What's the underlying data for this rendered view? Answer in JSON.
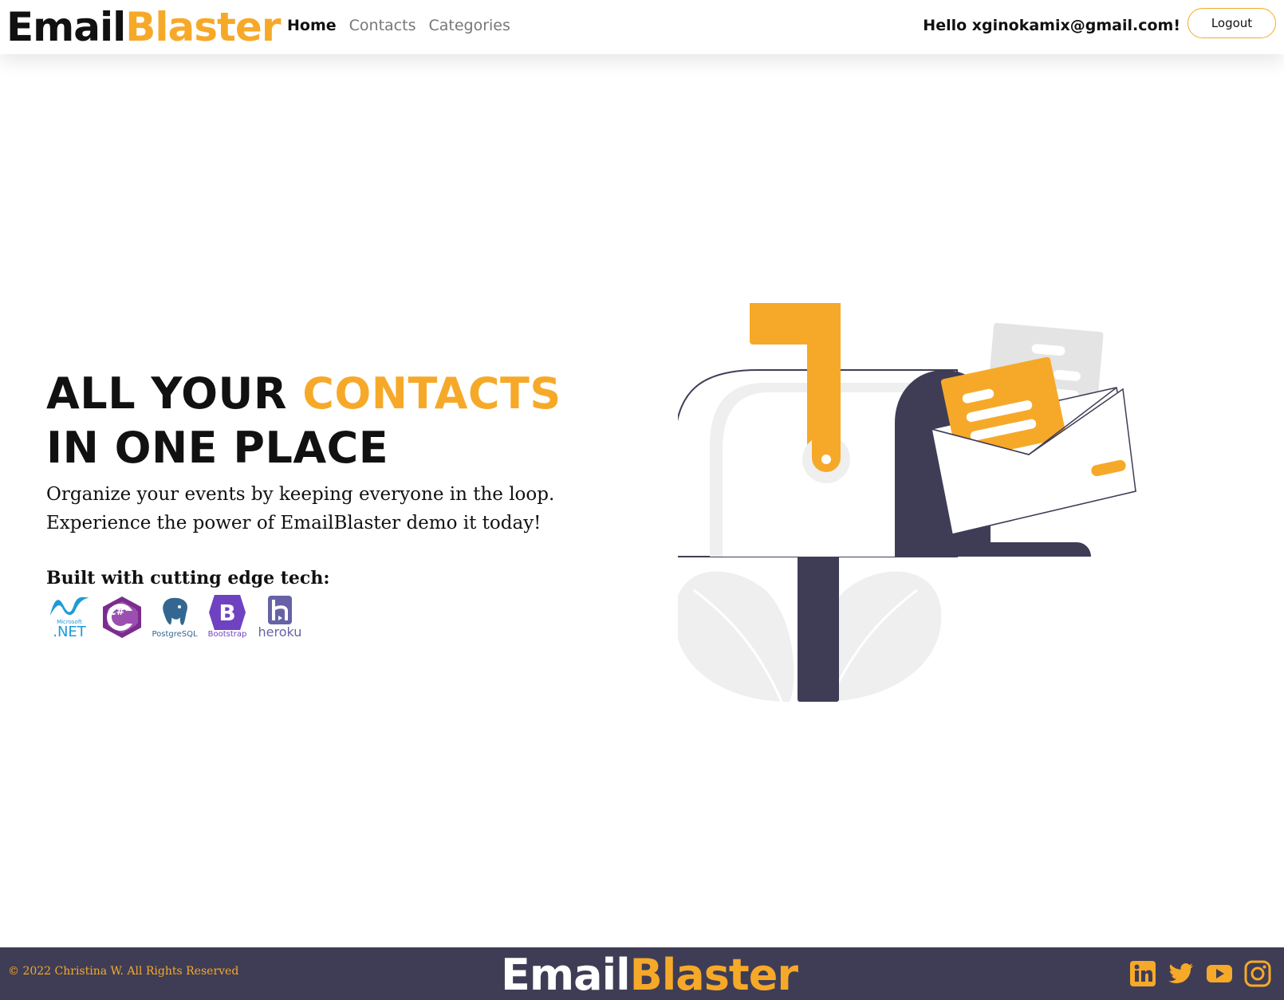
{
  "nav": {
    "brand_part1": "Email",
    "brand_part2": "Blaster",
    "links": [
      {
        "label": "Home",
        "active": true
      },
      {
        "label": "Contacts",
        "active": false
      },
      {
        "label": "Categories",
        "active": false
      }
    ],
    "greeting": "Hello xginokamix@gmail.com!",
    "logout_label": "Logout"
  },
  "hero": {
    "title_line1_a": "ALL YOUR ",
    "title_line1_b": "CONTACTS",
    "title_line2": "IN ONE PLACE",
    "desc_line1": "Organize your events by keeping everyone in the loop.",
    "desc_line2": "Experience the power of EmailBlaster demo it today!",
    "tech_label": "Built with cutting edge tech:",
    "tech": [
      {
        "icon": "dotnet-icon",
        "caption": ".NET",
        "sub": "Microsoft"
      },
      {
        "icon": "csharp-icon",
        "caption": "C#"
      },
      {
        "icon": "postgresql-icon",
        "caption": "PostgreSQL"
      },
      {
        "icon": "bootstrap-icon",
        "caption": "Bootstrap",
        "letter": "B"
      },
      {
        "icon": "heroku-icon",
        "caption": "heroku"
      }
    ]
  },
  "footer": {
    "copyright": "© 2022 Christina W. All Rights Reserved",
    "brand_part1": "Email",
    "brand_part2": "Blaster",
    "socials": [
      "linkedin-icon",
      "twitter-icon",
      "youtube-icon",
      "instagram-icon"
    ]
  },
  "colors": {
    "accent": "#f6a929",
    "dark": "#3f3d56"
  }
}
